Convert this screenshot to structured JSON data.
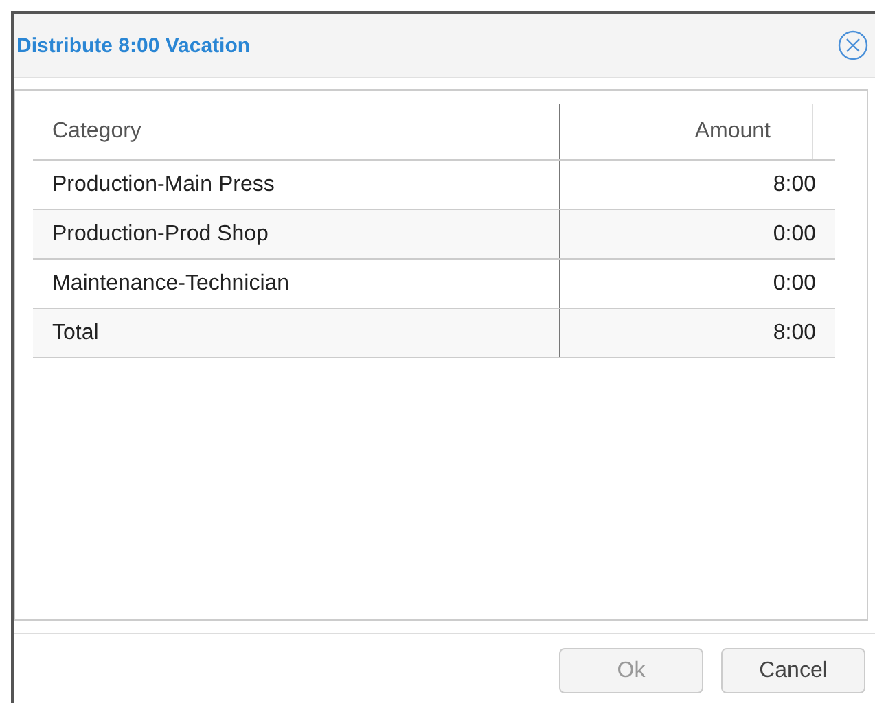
{
  "dialog": {
    "title": "Distribute 8:00 Vacation"
  },
  "table": {
    "columns": [
      "Category",
      "Amount"
    ],
    "rows": [
      {
        "category": "Production-Main Press",
        "amount": "8:00"
      },
      {
        "category": "Production-Prod Shop",
        "amount": "0:00"
      },
      {
        "category": "Maintenance-Technician",
        "amount": "0:00"
      },
      {
        "category": "Total",
        "amount": "8:00"
      }
    ]
  },
  "buttons": [
    {
      "label": "Ok",
      "disabled": true
    },
    {
      "label": "Cancel",
      "disabled": false
    }
  ]
}
